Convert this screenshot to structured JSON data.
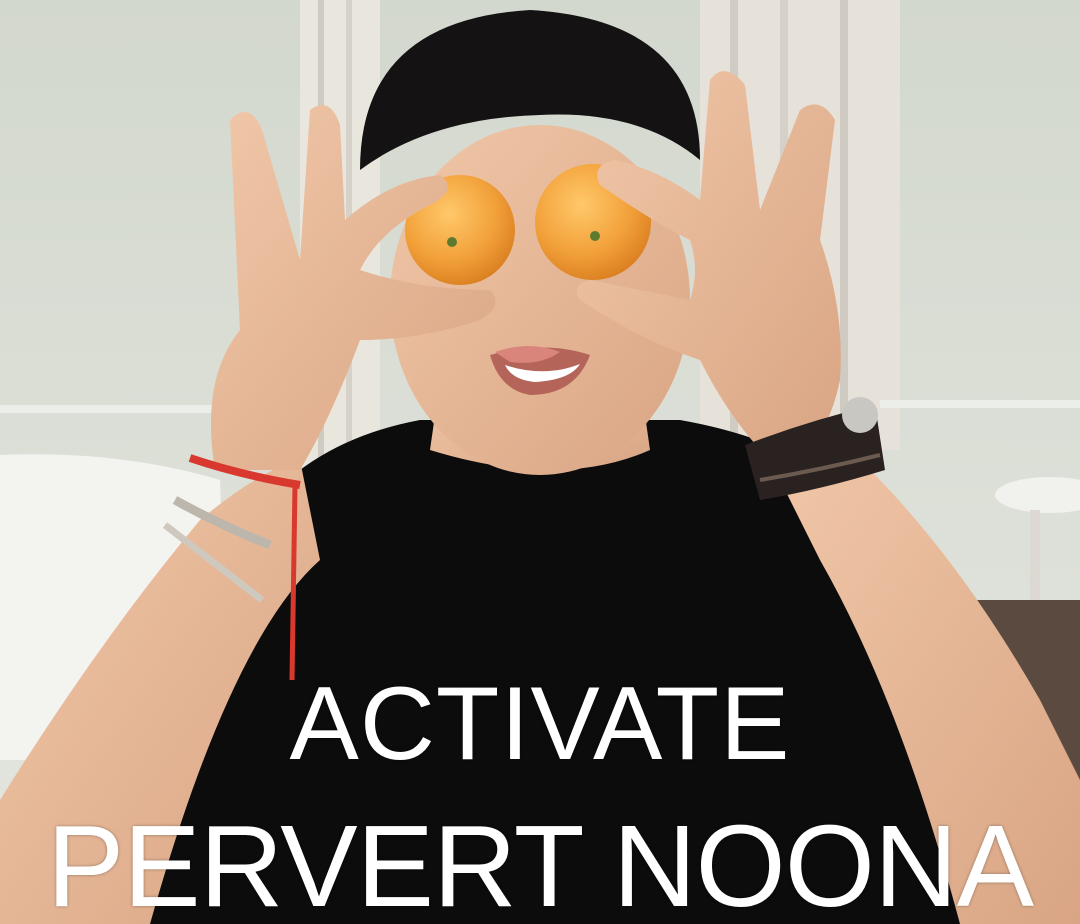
{
  "meme": {
    "caption_line_1": "ACTIVATE",
    "caption_line_2": "PERVERT NOONA"
  },
  "colors": {
    "caption_text": "#ffffff",
    "wall": "#dfe2da",
    "shirt": "#0c0c0c",
    "beanie": "#141212",
    "skin": "#e8bb9a",
    "orange": "#f2a13a",
    "wristband": "#d9382e"
  }
}
